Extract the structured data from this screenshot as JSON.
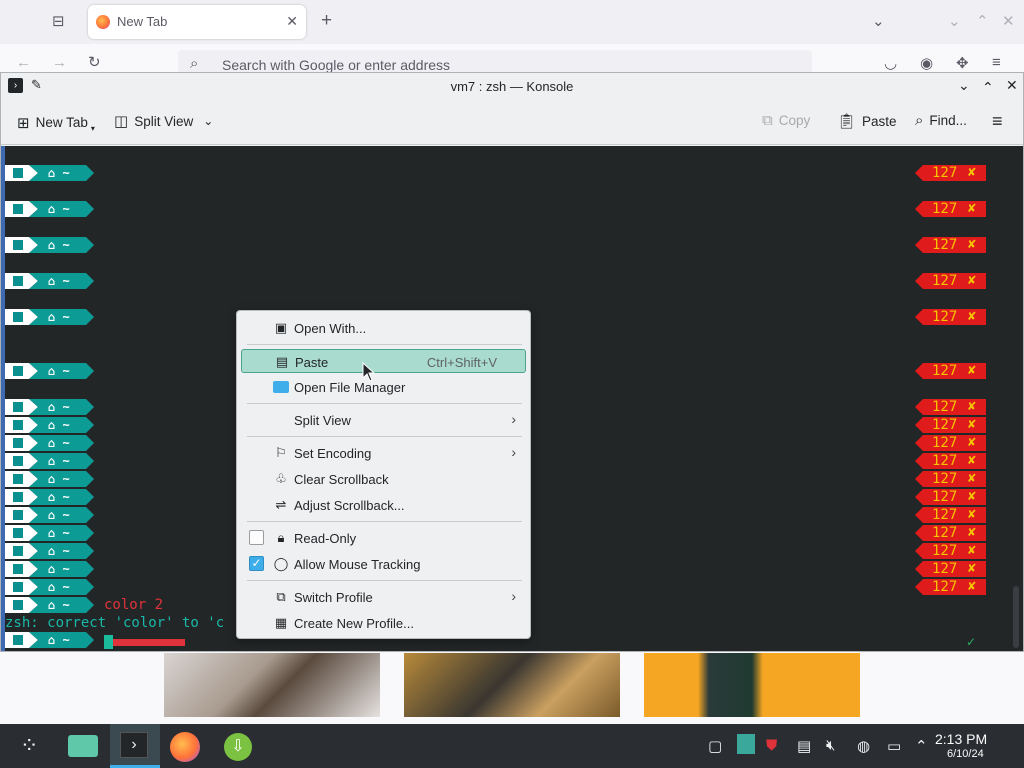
{
  "browser": {
    "tab_label": "New Tab",
    "tab_close": "✕",
    "new_tab_glyph": "+",
    "url_placeholder": "Search with Google or enter address"
  },
  "konsole": {
    "title": "vm7 : zsh — Konsole",
    "toolbar": {
      "new_tab": "New Tab",
      "split_view": "Split View",
      "copy": "Copy",
      "paste": "Paste",
      "find": "Find..."
    },
    "prompt_text": "⌂ ~",
    "error_code": "127",
    "error_mark": "✘",
    "typed_command": "color 2",
    "correction_text": "zsh: correct 'color' to 'c",
    "ok_mark": "✓"
  },
  "context_menu": {
    "items": [
      {
        "label": "Open With...",
        "icon": "open-with-icon"
      },
      {
        "label": "Paste",
        "shortcut": "Ctrl+Shift+V",
        "icon": "paste-icon"
      },
      {
        "label": "Open File Manager",
        "icon": "folder-icon"
      },
      {
        "label": "Split View",
        "icon": ""
      },
      {
        "label": "Set Encoding",
        "icon": "flag-icon"
      },
      {
        "label": "Clear Scrollback",
        "icon": "broom-icon"
      },
      {
        "label": "Adjust Scrollback...",
        "icon": "sliders-icon"
      },
      {
        "label": "Read-Only",
        "icon": "lock-icon",
        "checked": false
      },
      {
        "label": "Allow Mouse Tracking",
        "icon": "mouse-icon",
        "checked": true
      },
      {
        "label": "Switch Profile",
        "icon": "switch-profile-icon"
      },
      {
        "label": "Create New Profile...",
        "icon": "new-profile-icon"
      }
    ]
  },
  "taskbar": {
    "time": "2:13 PM",
    "date": "6/10/24"
  },
  "colors": {
    "prompt_teal": "#0d9b95",
    "error_red": "#e01b1b",
    "error_text": "#f5c400",
    "menu_highlight": "#a9dccf",
    "accent": "#3daee9"
  }
}
